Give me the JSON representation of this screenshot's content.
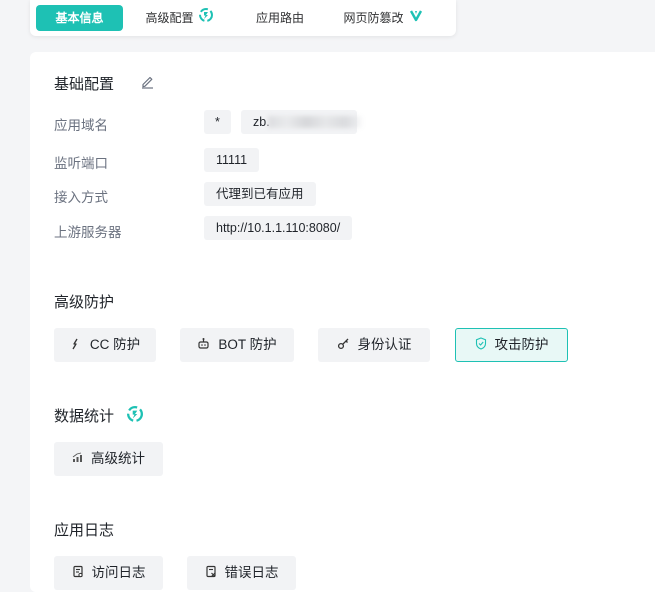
{
  "tabs": [
    {
      "label": "基本信息",
      "active": true,
      "badge": false
    },
    {
      "label": "高级配置",
      "active": false,
      "badge": true
    },
    {
      "label": "应用路由",
      "active": false,
      "badge": false
    },
    {
      "label": "网页防篡改",
      "active": false,
      "badge": true
    }
  ],
  "basic": {
    "title": "基础配置",
    "fields": {
      "domain": {
        "label": "应用域名",
        "prefix": "*",
        "value": "zb."
      },
      "port": {
        "label": "监听端口",
        "value": "11111"
      },
      "access": {
        "label": "接入方式",
        "value": "代理到已有应用"
      },
      "upstream": {
        "label": "上游服务器",
        "value": "http://10.1.1.110:8080/"
      }
    }
  },
  "protection": {
    "title": "高级防护",
    "buttons": [
      {
        "label": "CC 防护",
        "icon": "cc-icon",
        "active": false
      },
      {
        "label": "BOT 防护",
        "icon": "bot-icon",
        "active": false
      },
      {
        "label": "身份认证",
        "icon": "key-icon",
        "active": false
      },
      {
        "label": "攻击防护",
        "icon": "shield-icon",
        "active": true
      }
    ]
  },
  "stats": {
    "title": "数据统计",
    "buttons": [
      {
        "label": "高级统计",
        "icon": "chart-icon"
      }
    ]
  },
  "logs": {
    "title": "应用日志",
    "buttons": [
      {
        "label": "访问日志",
        "icon": "access-log-icon"
      },
      {
        "label": "错误日志",
        "icon": "error-log-icon"
      }
    ]
  },
  "colors": {
    "accent": "#1ec1b4",
    "chip_bg": "#f2f3f5",
    "page_bg": "#f4f5f7"
  }
}
